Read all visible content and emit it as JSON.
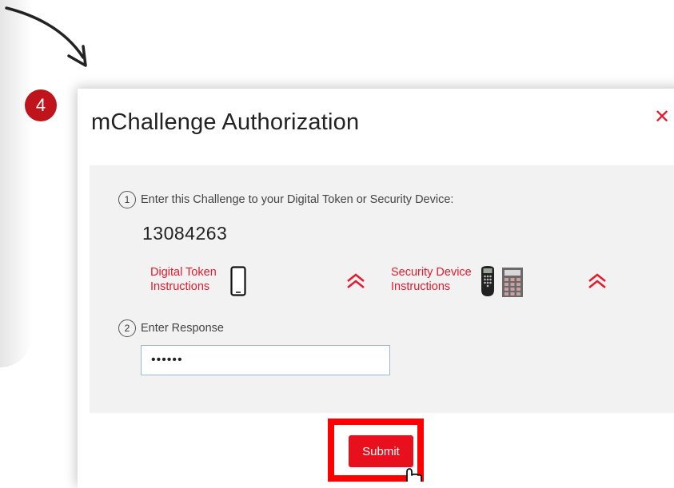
{
  "step_badge": "4",
  "dialog": {
    "title": "mChallenge Authorization",
    "close_label": "✕"
  },
  "step1": {
    "number": "1",
    "text": "Enter this Challenge to your Digital Token or Security Device:",
    "challenge_code": "13084263"
  },
  "instructions": {
    "digital_token": {
      "line1": "Digital Token",
      "line2": "Instructions",
      "icon": "smartphone-icon"
    },
    "security_device": {
      "line1": "Security Device",
      "line2": "Instructions",
      "icon": "security-device-icon"
    }
  },
  "step2": {
    "number": "2",
    "text": "Enter Response",
    "response_value": "••••••"
  },
  "submit_label": "Submit",
  "colors": {
    "accent_red": "#e8192c",
    "badge_red": "#c0141c",
    "highlight_red": "#ff0000",
    "panel_grey": "#f2f2f2"
  }
}
